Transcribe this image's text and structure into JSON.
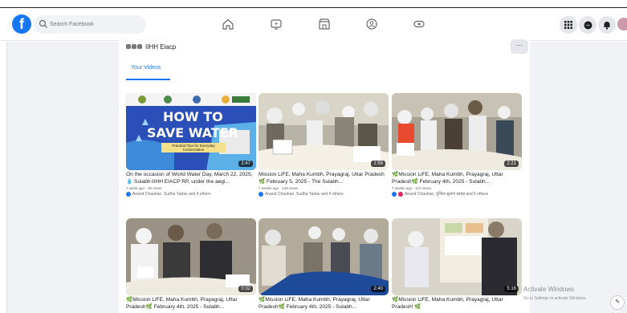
{
  "topbar": {
    "logo": "f",
    "search_placeholder": "Search Facebook",
    "nav_icons": [
      "home-icon",
      "video-icon",
      "marketplace-icon",
      "groups-icon",
      "gaming-icon"
    ],
    "right_icons": [
      "menu-grid-icon",
      "messenger-icon",
      "notifications-icon",
      "avatar"
    ]
  },
  "page": {
    "name": "IIHH Eiacp",
    "more_label": "···",
    "active_tab": "Your Videos"
  },
  "videos": [
    {
      "title": "On the occasion of World Water Day, March 22, 2025, 💧 Sulabh-IIHH EIACP RP, under the aegi...",
      "meta": "1 week ago · 36 views",
      "authors": "Anand Chauhan, Sudha Yadav and 4 others",
      "duration": "2:47",
      "thumb_title": "HOW TO",
      "thumb_title2": "SAVE WATER",
      "thumb_sub": "Practical Tips for Everyday Conservation"
    },
    {
      "title": "Mission LiFE, Maha Kumbh, Prayagraj, Uttar Pradesh 🌿 February 5, 2025 - The Sulabh...",
      "meta": "7 weeks ago · 148 views",
      "authors": "Anand Chauhan, Sudha Yadav and 4 others",
      "duration": "1:59",
      "thumb_title": "",
      "thumb_title2": "",
      "thumb_sub": ""
    },
    {
      "title": "🌿Mission LiFE, Maha Kumbh, Prayagraj, Uttar Pradesh🌿 February 4th, 2025 - Sulabh...",
      "meta": "7 weeks ago · 113 views",
      "authors": "Anand Chauhan, पूजिता सुलंगा प्रसान्न and 5 others",
      "duration": "2:21",
      "thumb_title": "",
      "thumb_title2": "",
      "thumb_sub": ""
    },
    {
      "title": "🌿Mission LiFE, Maha Kumbh, Prayagraj, Uttar Pradesh🌿 February 4th, 2025 - Sulabh...",
      "meta": "",
      "authors": "",
      "duration": "0:32",
      "thumb_title": "",
      "thumb_title2": "",
      "thumb_sub": ""
    },
    {
      "title": "🌿Mission LiFE, Maha Kumbh, Prayagraj, Uttar Pradesh🌿 February 4th, 2025 - Sulabh...",
      "meta": "",
      "authors": "",
      "duration": "2:40",
      "thumb_title": "",
      "thumb_title2": "",
      "thumb_sub": ""
    },
    {
      "title": "🌿Mission LiFE, Maha Kumbh, Prayagraj, Uttar Pradesh! 🌿",
      "meta": "",
      "authors": "",
      "duration": "5:16",
      "thumb_title": "",
      "thumb_title2": "",
      "thumb_sub": ""
    }
  ],
  "watermark": {
    "line1": "Activate Windows",
    "line2": "Go to Settings to activate Windows."
  },
  "colors": {
    "brand": "#1877f2",
    "bg": "#f0f2f5"
  }
}
